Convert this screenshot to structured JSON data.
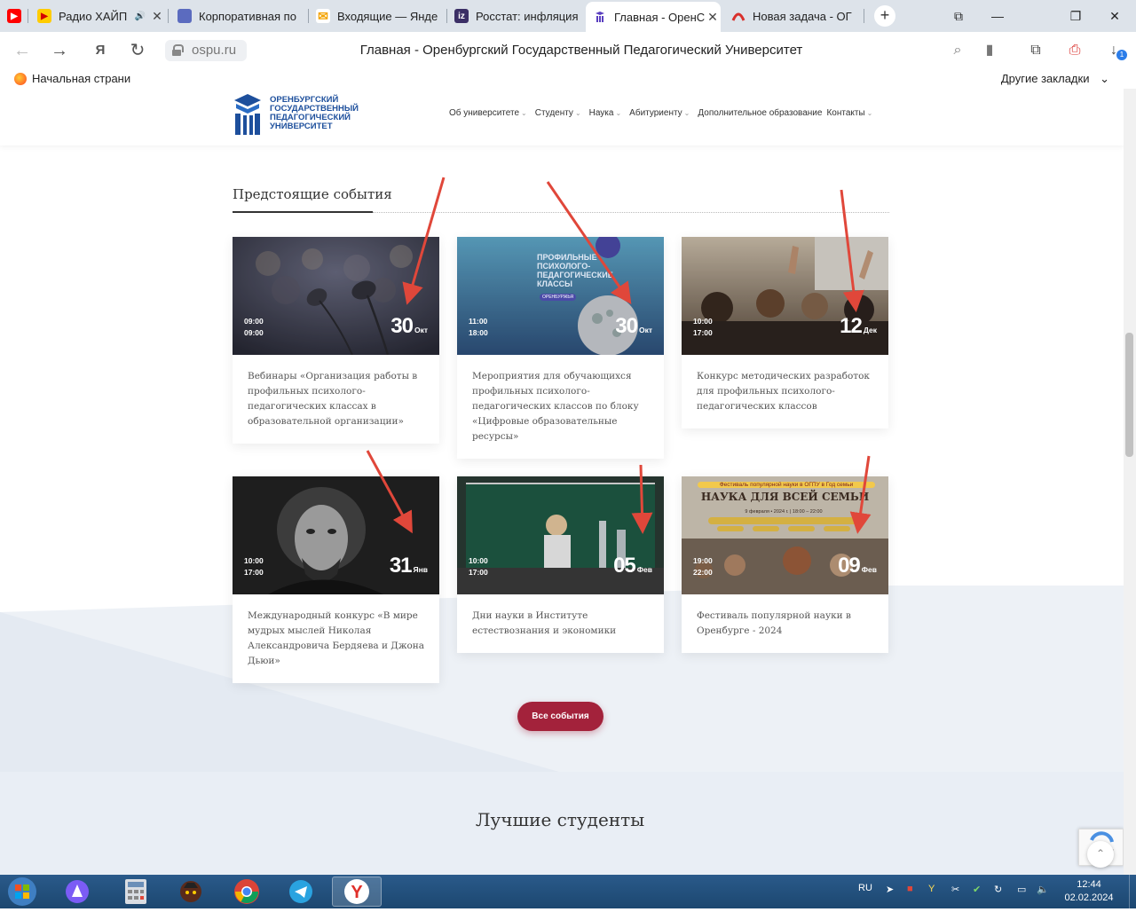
{
  "browser": {
    "tabs": [
      {
        "title": "",
        "icon": "youtube-icon",
        "color": "#ff0000"
      },
      {
        "title": "Радио ХАЙП",
        "icon": "yandex-music-icon",
        "color": "#ffcc00"
      },
      {
        "title": "Корпоративная по",
        "icon": "corporate-portal-icon",
        "color": "#5b6bbf"
      },
      {
        "title": "Входящие — Янде",
        "icon": "mail-icon",
        "color": "#f4a300"
      },
      {
        "title": "Росстат: инфляция",
        "icon": "iz-icon",
        "color": "#3b2f66"
      },
      {
        "title": "Главная - ОренС",
        "icon": "ospu-icon",
        "color": "#5a3fc0"
      },
      {
        "title": "Новая задача - ОГ",
        "icon": "task-icon",
        "color": "#d9302c"
      }
    ],
    "address": "ospu.ru",
    "page_title": "Главная - Оренбургский Государственный Педагогический Университет",
    "bookmark_home": "Начальная страни",
    "bookmark_other": "Другие закладки",
    "downloads_badge": "1"
  },
  "site": {
    "logo_text": "ОРЕНБУРГСКИЙ ГОСУДАРСТВЕННЫЙ ПЕДАГОГИЧЕСКИЙ УНИВЕРСИТЕТ",
    "nav": [
      "Об университете",
      "Студенту",
      "Наука",
      "Абитуриенту",
      "Дополнительное образование",
      "Контакты"
    ],
    "events_title": "Предстоящие события",
    "events": [
      {
        "start": "09:00",
        "end": "09:00",
        "day": "30",
        "month": "Окт",
        "title": "Вебинары «Организация работы в профильных психолого-педагогических классах в образовательной организации»"
      },
      {
        "start": "11:00",
        "end": "18:00",
        "day": "30",
        "month": "Окт",
        "title": "Мероприятия для обучающихся профильных психолого-педагогических классов по блоку «Цифровые образовательные ресурсы»"
      },
      {
        "start": "10:00",
        "end": "17:00",
        "day": "12",
        "month": "Дек",
        "title": "Конкурс методических разработок для профильных психолого-педагогических классов"
      },
      {
        "start": "10:00",
        "end": "17:00",
        "day": "31",
        "month": "Янв",
        "title": "Международный конкурс «В мире мудрых мыслей Николая Александровича Бердяева и Джона Дьюи»"
      },
      {
        "start": "10:00",
        "end": "17:00",
        "day": "05",
        "month": "Фев",
        "title": "Дни науки в Институте естествознания и экономики"
      },
      {
        "start": "19:00",
        "end": "22:00",
        "day": "09",
        "month": "Фев",
        "title": "Фестиваль популярной науки в Оренбурге - 2024"
      }
    ],
    "card2_banner": "ПРОФИЛЬНЫЕ ПСИХОЛОГО-ПЕДАГОГИЧЕСКИЕ КЛАССЫ",
    "card2_banner_sub": "ОРЕНБУРЖЬЯ",
    "card6_banner_top": "Фестиваль популярной науки в ОГПУ в Год семьи",
    "card6_banner_main": "НАУКА ДЛЯ ВСЕЙ СЕМЬИ",
    "card6_banner_date": "9 февраля • 2024 г. | 18:00 – 22:00",
    "all_events_button": "Все события",
    "best_students_title": "Лучшие студенты"
  },
  "taskbar": {
    "lang": "RU",
    "time": "12:44",
    "date": "02.02.2024"
  },
  "colors": {
    "accent": "#a3223b",
    "brand_blue": "#1d4f9c",
    "arrow_red": "#e0473a"
  }
}
